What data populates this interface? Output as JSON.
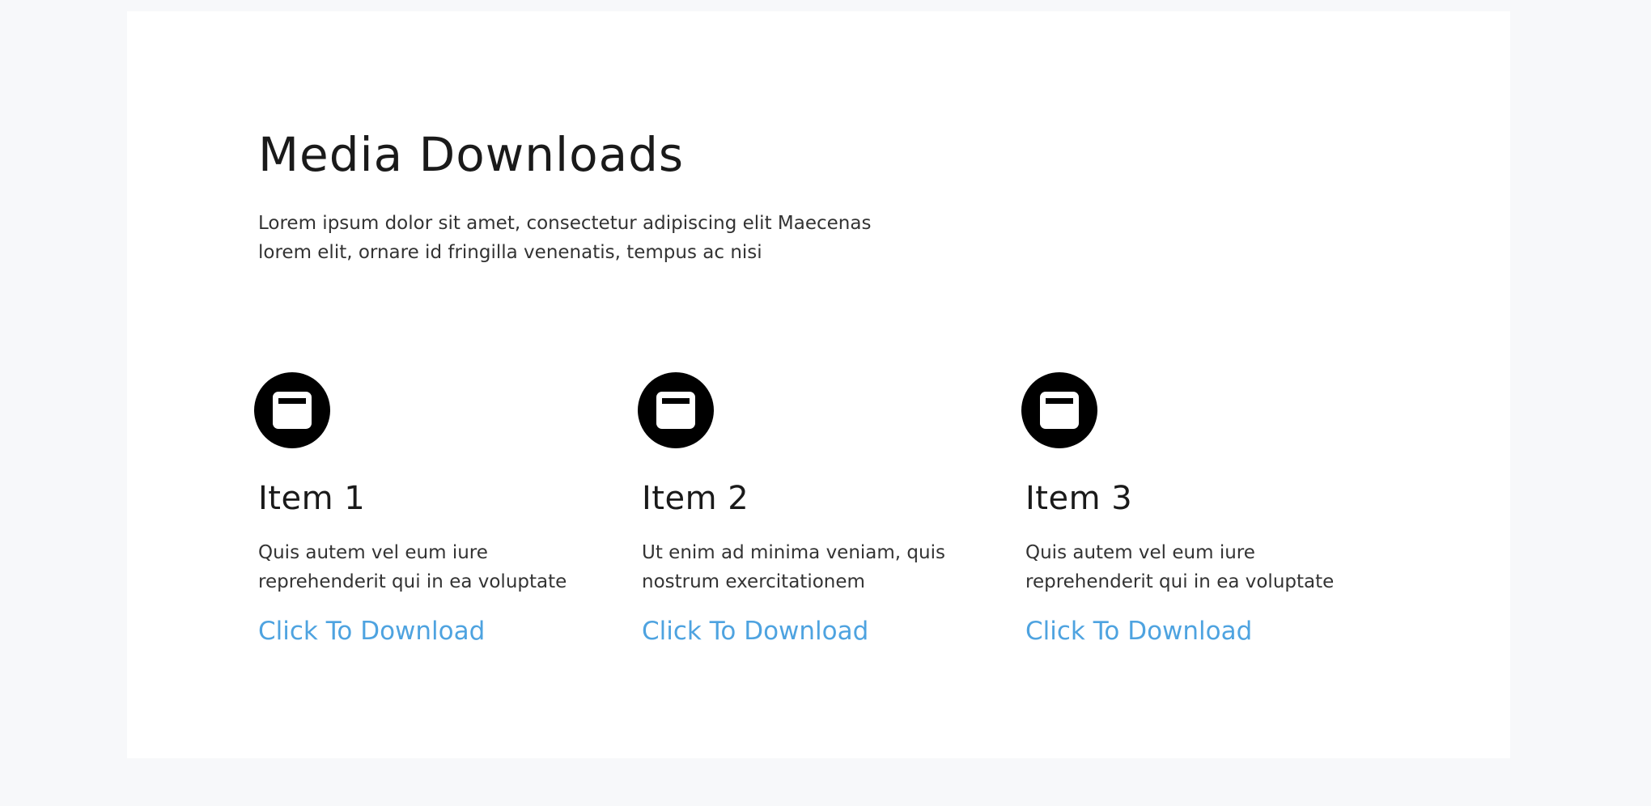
{
  "section": {
    "title": "Media Downloads",
    "intro": "Lorem ipsum dolor sit amet, consectetur adipiscing elit Maecenas lorem elit, ornare id fringilla venenatis, tempus ac nisi"
  },
  "items": [
    {
      "icon": "window-icon",
      "title": "Item 1",
      "description": "Quis autem vel eum iure reprehenderit qui in ea voluptate",
      "link_label": "Click To Download"
    },
    {
      "icon": "window-icon",
      "title": "Item 2",
      "description": "Ut enim ad minima veniam, quis nostrum exercitationem",
      "link_label": "Click To Download"
    },
    {
      "icon": "window-icon",
      "title": "Item 3",
      "description": "Quis autem vel eum iure reprehenderit qui in ea voluptate",
      "link_label": "Click To Download"
    }
  ],
  "colors": {
    "background": "#f7f8fa",
    "card": "#ffffff",
    "text": "#1a1a1a",
    "link": "#4ea3e0",
    "icon_bg": "#000000"
  }
}
